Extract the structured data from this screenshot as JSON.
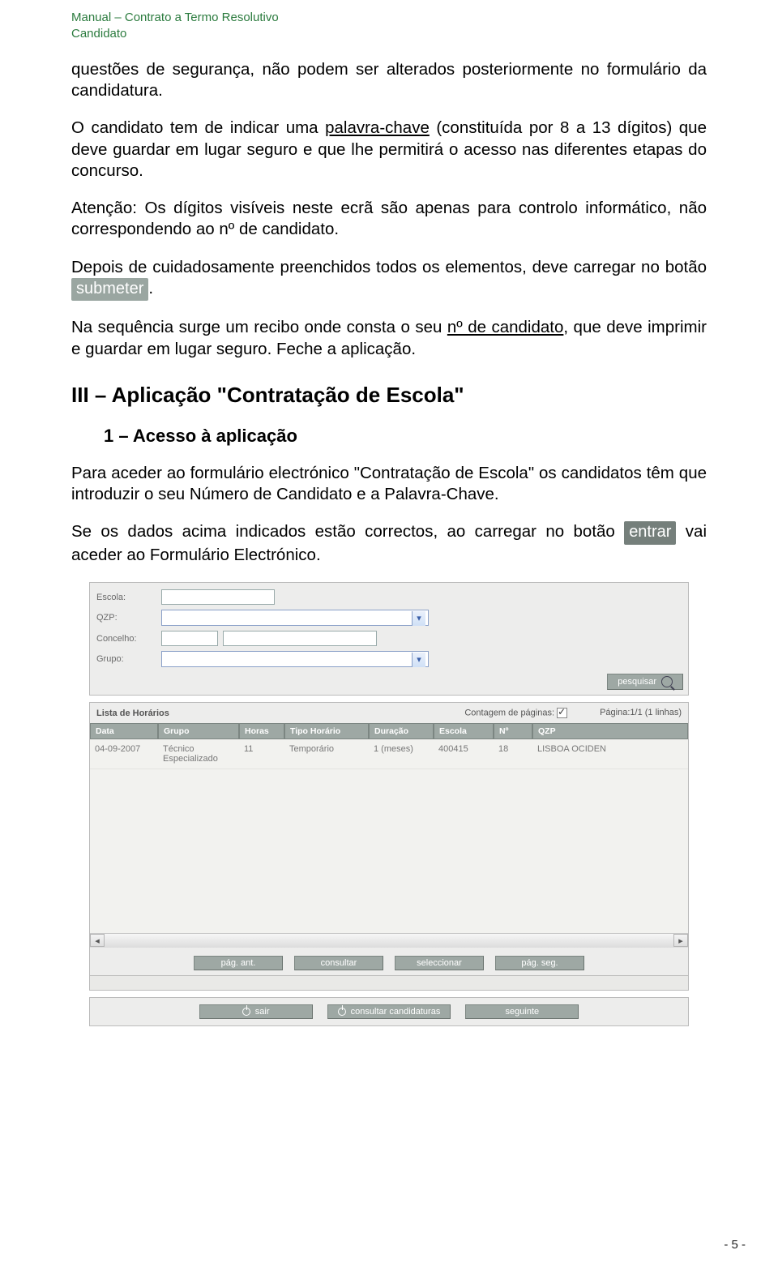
{
  "header": {
    "line1": "Manual – Contrato a Termo Resolutivo",
    "line2": "Candidato"
  },
  "p1": "questões de segurança, não podem ser alterados posteriormente no formulário da candidatura.",
  "p2a": "O candidato tem de indicar uma ",
  "p2u": "palavra-chave",
  "p2b": " (constituída por 8 a 13 dígitos) que deve guardar em lugar seguro e que lhe permitirá o acesso nas diferentes etapas do concurso.",
  "p3": "Atenção: Os dígitos visíveis neste ecrã são apenas para controlo informático, não correspondendo ao nº de candidato.",
  "p4a": "Depois de cuidadosamente preenchidos todos os elementos, deve carregar no botão ",
  "p4btn": "submeter",
  "p4b": ".",
  "p5a": "Na sequência surge um recibo onde consta o seu ",
  "p5u": "nº de candidato",
  "p5b": ", que deve imprimir e guardar em lugar seguro. Feche a aplicação.",
  "h2": "III – Aplicação \"Contratação de Escola\"",
  "h3": "1 – Acesso à aplicação",
  "p6": "Para aceder ao formulário electrónico \"Contratação de Escola\" os candidatos têm que introduzir o seu Número de Candidato e a Palavra-Chave.",
  "p7a": "Se os dados acima indicados estão correctos, ao carregar no botão ",
  "p7btn": "entrar",
  "p7b": " vai aceder ao Formulário Electrónico.",
  "form": {
    "escola": "Escola:",
    "qzp": "QZP:",
    "concelho": "Concelho:",
    "grupo": "Grupo:",
    "pesquisar": "pesquisar"
  },
  "list": {
    "title": "Lista de Horários",
    "contagem": "Contagem de páginas:",
    "pagina": "Página:1/1 (1 linhas)",
    "cols": [
      "Data",
      "Grupo",
      "Horas",
      "Tipo Horário",
      "Duração",
      "Escola",
      "Nº",
      "QZP"
    ],
    "row": [
      "04-09-2007",
      "Técnico Especializado",
      "11",
      "Temporário",
      "1 (meses)",
      "400415",
      "18",
      "LISBOA OCIDEN"
    ]
  },
  "nav": {
    "ant": "pág. ant.",
    "consultar": "consultar",
    "seleccionar": "seleccionar",
    "seg": "pág. seg."
  },
  "bottom": {
    "sair": "sair",
    "cc": "consultar candidaturas",
    "seguinte": "seguinte"
  },
  "page": "- 5 -"
}
